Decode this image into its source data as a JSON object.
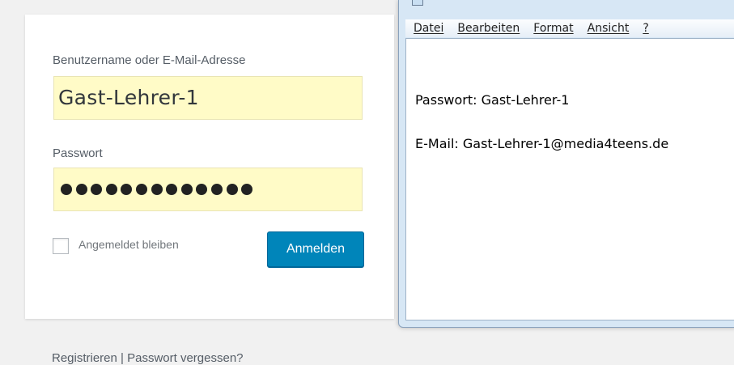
{
  "login": {
    "username_label": "Benutzername oder E-Mail-Adresse",
    "username_value": "Gast-Lehrer-1",
    "password_label": "Passwort",
    "password_masked": "●●●●●●●●●●●●●",
    "password_length": 13,
    "remember_label": "Angemeldet bleiben",
    "remember_checked": false,
    "submit_label": "Anmelden",
    "register_link": "Registrieren",
    "separator": " | ",
    "forgot_link": "Passwort vergessen?"
  },
  "notepad": {
    "menu": [
      "Datei",
      "Bearbeiten",
      "Format",
      "Ansicht",
      "?"
    ],
    "lines": [
      "Passwort: Gast-Lehrer-1",
      "E-Mail: Gast-Lehrer-1@media4teens.de"
    ]
  },
  "colors": {
    "button": "#0085ba",
    "autofill": "#fffbc7",
    "background": "#f1f1f1"
  }
}
